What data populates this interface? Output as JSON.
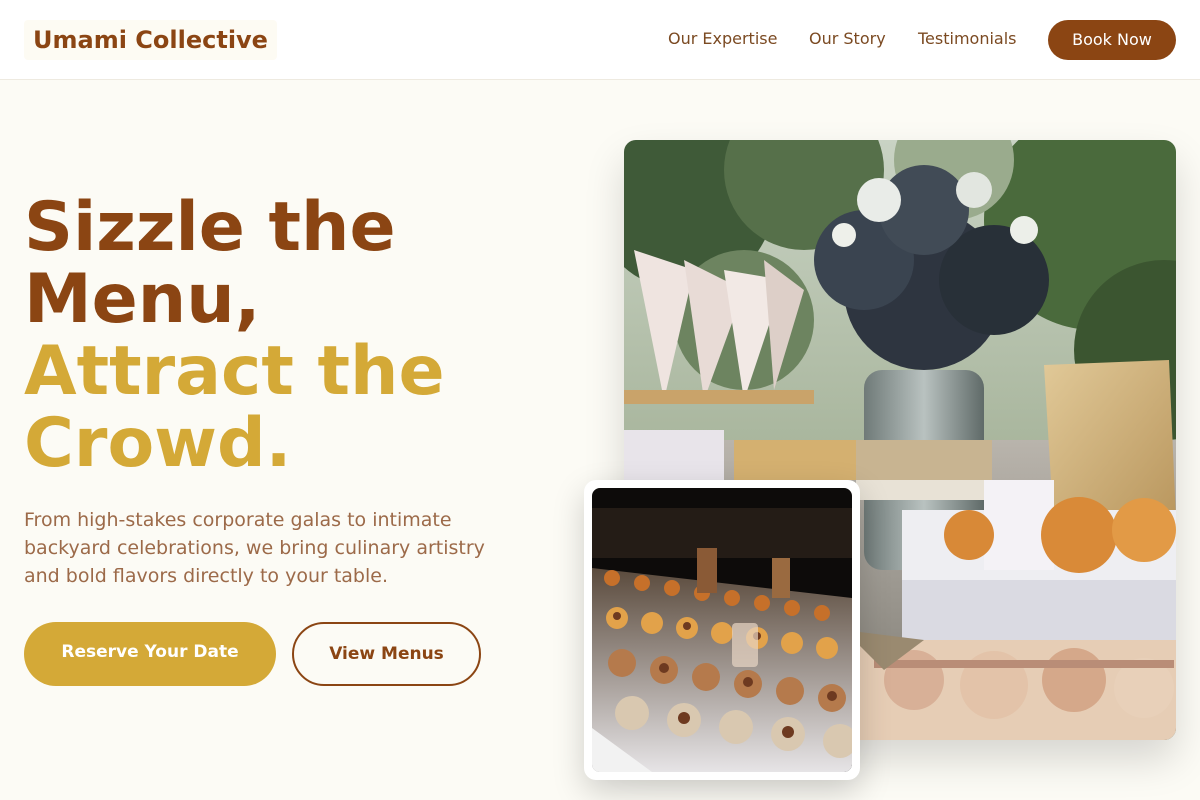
{
  "header": {
    "logo": "Umami Collective",
    "nav": {
      "expertise": "Our Expertise",
      "story": "Our Story",
      "testimonials": "Testimonials"
    },
    "book_label": "Book Now"
  },
  "hero": {
    "headline": {
      "line1": "Sizzle the",
      "line2": "Menu,",
      "line3": "Attract the",
      "line4": "Crowd."
    },
    "subtitle": "From high-stakes corporate galas to intimate backyard celebrations, we bring culinary artistry and bold flavors directly to your table.",
    "primary_cta": "Reserve Your Date",
    "secondary_cta": "View Menus"
  },
  "colors": {
    "brand_brown": "#8b4513",
    "brand_gold": "#d4a937",
    "page_background": "#fcfbf5",
    "body_text": "#9c6a49"
  }
}
